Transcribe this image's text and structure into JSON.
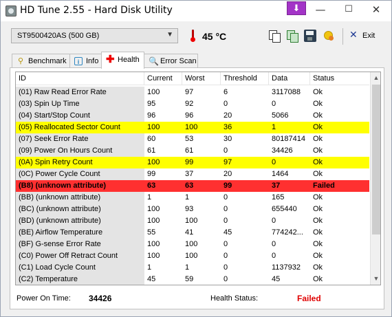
{
  "window": {
    "title": "HD Tune 2.55 - Hard Disk Utility",
    "download_glyph": "⬇",
    "minimize_glyph": "—",
    "maximize_glyph": "☐",
    "close_glyph": "✕"
  },
  "toolbar": {
    "drive": "ST9500420AS (500 GB)",
    "temperature": "45 °C",
    "exit_label": "Exit",
    "exit_glyph": "✕"
  },
  "tabs": [
    {
      "label": "Benchmark",
      "icon": "benchmark-icon",
      "active": false
    },
    {
      "label": "Info",
      "icon": "info-icon",
      "active": false
    },
    {
      "label": "Health",
      "icon": "health-icon",
      "active": true
    },
    {
      "label": "Error Scan",
      "icon": "error-scan-icon",
      "active": false
    }
  ],
  "tab_glyphs": {
    "benchmark": "⚲",
    "info": "i",
    "health": "✚",
    "error_scan": "🔍"
  },
  "table": {
    "columns": [
      "ID",
      "Current",
      "Worst",
      "Threshold",
      "Data",
      "Status"
    ],
    "rows": [
      {
        "id": "(01) Raw Read Error Rate",
        "current": "100",
        "worst": "97",
        "threshold": "6",
        "data": "3117088",
        "status": "Ok",
        "highlight": ""
      },
      {
        "id": "(03) Spin Up Time",
        "current": "95",
        "worst": "92",
        "threshold": "0",
        "data": "0",
        "status": "Ok",
        "highlight": ""
      },
      {
        "id": "(04) Start/Stop Count",
        "current": "96",
        "worst": "96",
        "threshold": "20",
        "data": "5066",
        "status": "Ok",
        "highlight": ""
      },
      {
        "id": "(05) Reallocated Sector Count",
        "current": "100",
        "worst": "100",
        "threshold": "36",
        "data": "1",
        "status": "Ok",
        "highlight": "yellow"
      },
      {
        "id": "(07) Seek Error Rate",
        "current": "60",
        "worst": "53",
        "threshold": "30",
        "data": "80187414",
        "status": "Ok",
        "highlight": ""
      },
      {
        "id": "(09) Power On Hours Count",
        "current": "61",
        "worst": "61",
        "threshold": "0",
        "data": "34426",
        "status": "Ok",
        "highlight": ""
      },
      {
        "id": "(0A) Spin Retry Count",
        "current": "100",
        "worst": "99",
        "threshold": "97",
        "data": "0",
        "status": "Ok",
        "highlight": "yellow"
      },
      {
        "id": "(0C) Power Cycle Count",
        "current": "99",
        "worst": "37",
        "threshold": "20",
        "data": "1464",
        "status": "Ok",
        "highlight": ""
      },
      {
        "id": "(B8) (unknown attribute)",
        "current": "63",
        "worst": "63",
        "threshold": "99",
        "data": "37",
        "status": "Failed",
        "highlight": "red"
      },
      {
        "id": "(BB) (unknown attribute)",
        "current": "1",
        "worst": "1",
        "threshold": "0",
        "data": "165",
        "status": "Ok",
        "highlight": ""
      },
      {
        "id": "(BC) (unknown attribute)",
        "current": "100",
        "worst": "93",
        "threshold": "0",
        "data": "655440",
        "status": "Ok",
        "highlight": ""
      },
      {
        "id": "(BD) (unknown attribute)",
        "current": "100",
        "worst": "100",
        "threshold": "0",
        "data": "0",
        "status": "Ok",
        "highlight": ""
      },
      {
        "id": "(BE) Airflow Temperature",
        "current": "55",
        "worst": "41",
        "threshold": "45",
        "data": "774242...",
        "status": "Ok",
        "highlight": ""
      },
      {
        "id": "(BF) G-sense Error Rate",
        "current": "100",
        "worst": "100",
        "threshold": "0",
        "data": "0",
        "status": "Ok",
        "highlight": ""
      },
      {
        "id": "(C0) Power Off Retract Count",
        "current": "100",
        "worst": "100",
        "threshold": "0",
        "data": "0",
        "status": "Ok",
        "highlight": ""
      },
      {
        "id": "(C1) Load Cycle Count",
        "current": "1",
        "worst": "1",
        "threshold": "0",
        "data": "1137932",
        "status": "Ok",
        "highlight": ""
      },
      {
        "id": "(C2) Temperature",
        "current": "45",
        "worst": "59",
        "threshold": "0",
        "data": "45",
        "status": "Ok",
        "highlight": ""
      }
    ]
  },
  "scrollbar": {
    "up_glyph": "▲",
    "down_glyph": "▼"
  },
  "footer": {
    "power_on_label": "Power On Time:",
    "power_on_value": "34426",
    "health_label": "Health Status:",
    "health_value": "Failed"
  },
  "colors": {
    "warning_row": "#ffff00",
    "failed_row": "#ff3030",
    "failed_text": "#e00000"
  }
}
